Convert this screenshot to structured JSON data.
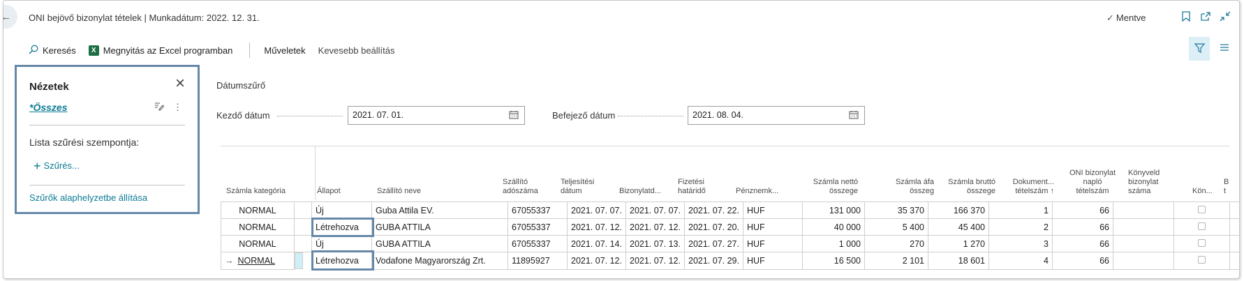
{
  "titlebar": {
    "title": "ONI bejövő bizonylat tételek | Munkadátum: 2022. 12. 31.",
    "saved_label": "Mentve"
  },
  "actionbar": {
    "search_label": "Keresés",
    "excel_label": "Megnyitás az Excel programban",
    "actions_label": "Műveletek",
    "fewer_options_label": "Kevesebb beállítás"
  },
  "views_panel": {
    "heading": "Nézetek",
    "all_label": "*Összes",
    "filter_criteria_label": "Lista szűrési szempontja:",
    "add_filter_label": "Szűrés...",
    "reset_label": "Szűrők alaphelyzetbe állítása"
  },
  "date_filter": {
    "heading": "Dátumszűrő",
    "start_label": "Kezdő dátum",
    "start_value": "2021. 07. 01.",
    "end_label": "Befejező dátum",
    "end_value": "2021. 08. 04."
  },
  "table": {
    "columns": [
      "Számla kategória",
      "Állapot",
      "Szállító neve",
      "Szállító adószáma",
      "Teljesítési dátum",
      "Bizonylatd...",
      "Fizetési határidő",
      "Pénznemk...",
      "Számla nettó összege",
      "Számla áfa összeg",
      "Számla bruttó összege",
      "Dokument... tételszám ↑",
      "ONI bizonylat napló tételszám",
      "Könyveld bizonylat száma",
      "Kön...",
      "B t"
    ],
    "rows": [
      {
        "category": "NORMAL",
        "status": "Új",
        "vendor": "Guba Attila EV.",
        "tax_id": "67055337",
        "perf_date": "2021. 07. 07.",
        "doc_date": "2021. 07. 07.",
        "due_date": "2021. 07. 22.",
        "currency": "HUF",
        "net": "131 000",
        "vat": "35 370",
        "gross": "166 370",
        "doc_line": "1",
        "oni_line": "66"
      },
      {
        "category": "NORMAL",
        "status": "Létrehozva",
        "vendor": "GUBA ATTILA",
        "tax_id": "67055337",
        "perf_date": "2021. 07. 12.",
        "doc_date": "2021. 07. 12.",
        "due_date": "2021. 07. 20.",
        "currency": "HUF",
        "net": "40 000",
        "vat": "5 400",
        "gross": "45 400",
        "doc_line": "2",
        "oni_line": "66"
      },
      {
        "category": "NORMAL",
        "status": "Új",
        "vendor": "GUBA ATTILA",
        "tax_id": "67055337",
        "perf_date": "2021. 07. 14.",
        "doc_date": "2021. 07. 13.",
        "due_date": "2021. 07. 27.",
        "currency": "HUF",
        "net": "1 000",
        "vat": "270",
        "gross": "1 270",
        "doc_line": "3",
        "oni_line": "66"
      },
      {
        "category": "NORMAL",
        "status": "Létrehozva",
        "vendor": "Vodafone Magyarország Zrt.",
        "tax_id": "11895927",
        "perf_date": "2021. 07. 12.",
        "doc_date": "2021. 07. 12.",
        "due_date": "2021. 07. 29.",
        "currency": "HUF",
        "net": "16 500",
        "vat": "2 101",
        "gross": "18 601",
        "doc_line": "4",
        "oni_line": "66"
      }
    ]
  },
  "icons": {
    "back": "arrow-left-icon",
    "bookmark": "bookmark-icon",
    "popout": "open-new-window-icon",
    "collapse": "collapse-icon",
    "search": "search-icon",
    "excel": "excel-icon",
    "filter": "filter-icon",
    "list": "list-icon",
    "close": "close-icon",
    "edit": "edit-view-icon",
    "more": "more-options-icon",
    "calendar": "calendar-icon",
    "row_arrow": "current-row-arrow-icon"
  },
  "colors": {
    "accent": "#0a7b95",
    "highlight_border": "#6688a8",
    "selected_cell": "#cfeef5"
  }
}
